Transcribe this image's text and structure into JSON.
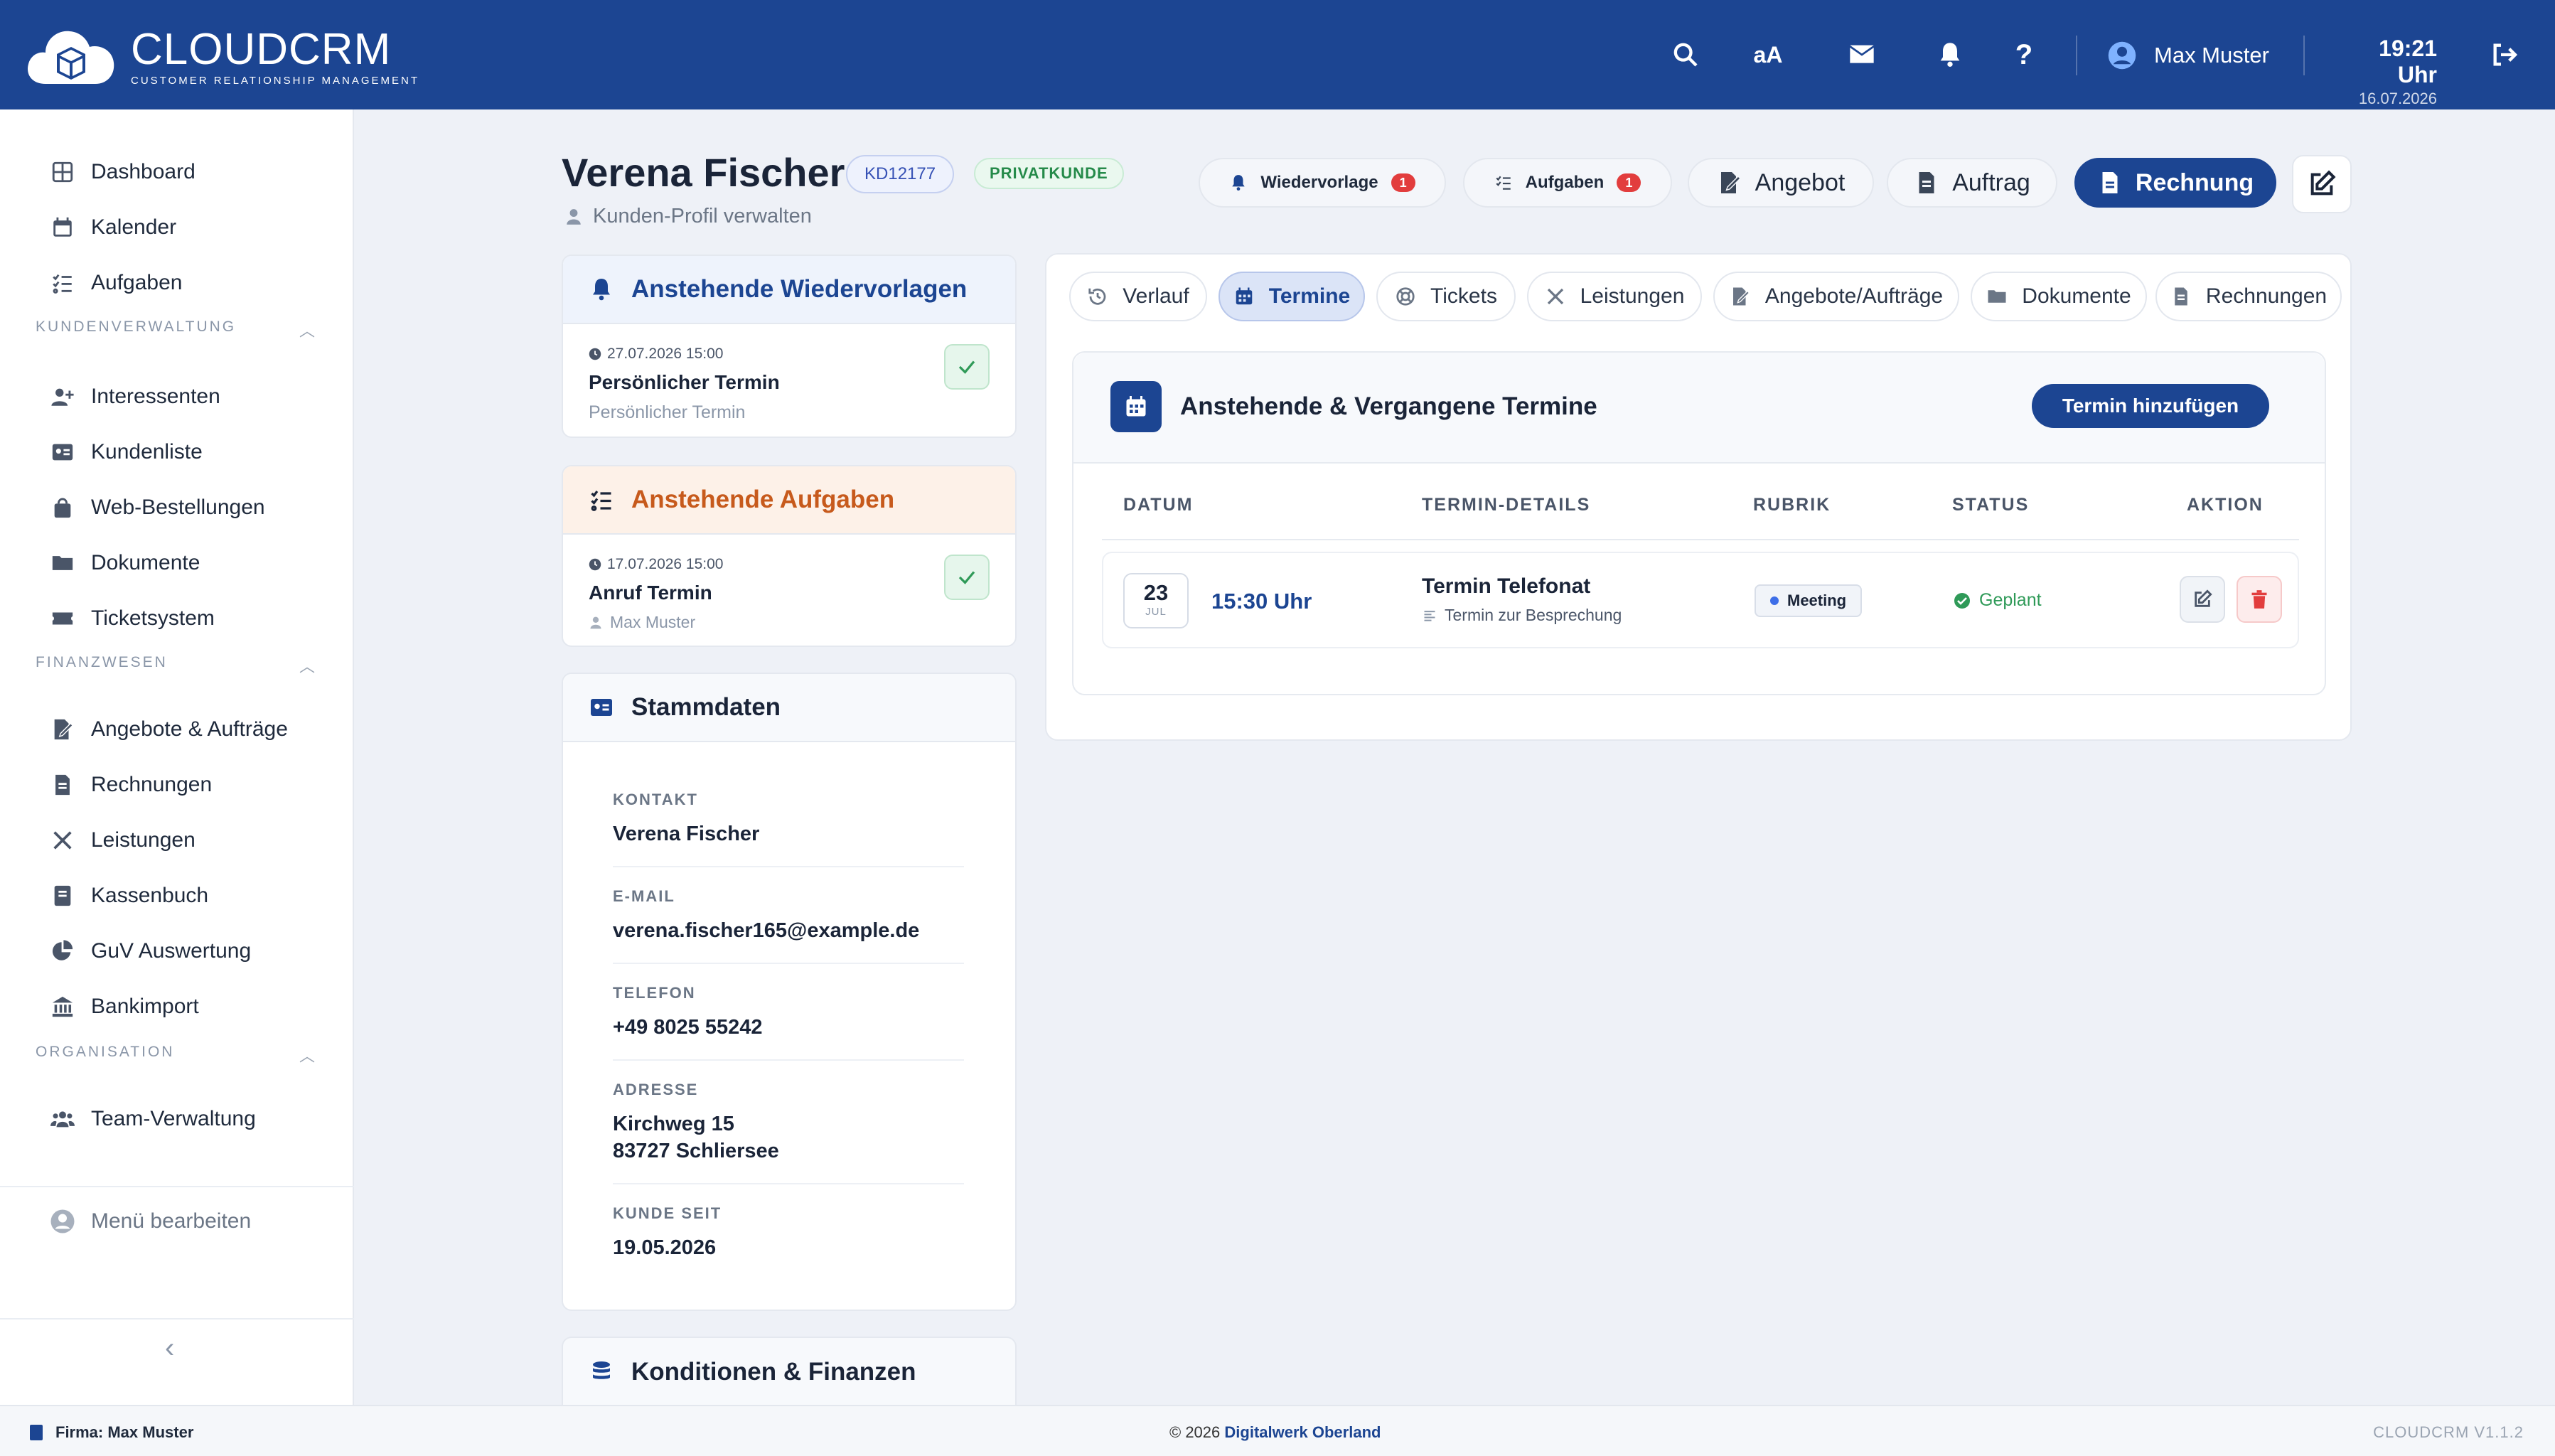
{
  "app": {
    "title": "CLOUDCRM",
    "subtitle": "CUSTOMER RELATIONSHIP MANAGEMENT",
    "font_toggle": "aA",
    "version": "CLOUDCRM V1.1.2"
  },
  "header": {
    "user_name": "Max Muster",
    "time": "19:21 Uhr",
    "date": "16.07.2026"
  },
  "sidebar": {
    "top": [
      {
        "label": "Dashboard",
        "icon": "dashboard-icon"
      },
      {
        "label": "Kalender",
        "icon": "calendar-icon"
      },
      {
        "label": "Aufgaben",
        "icon": "tasks-icon"
      }
    ],
    "sections": [
      {
        "title": "KUNDENVERWALTUNG",
        "items": [
          {
            "label": "Interessenten",
            "icon": "user-plus-icon"
          },
          {
            "label": "Kundenliste",
            "icon": "id-card-icon"
          },
          {
            "label": "Web-Bestellungen",
            "icon": "shopping-bag-icon"
          },
          {
            "label": "Dokumente",
            "icon": "folder-icon"
          },
          {
            "label": "Ticketsystem",
            "icon": "ticket-icon"
          }
        ]
      },
      {
        "title": "FINANZWESEN",
        "items": [
          {
            "label": "Angebote & Aufträge",
            "icon": "file-signature-icon"
          },
          {
            "label": "Rechnungen",
            "icon": "invoice-icon"
          },
          {
            "label": "Leistungen",
            "icon": "tools-icon"
          },
          {
            "label": "Kassenbuch",
            "icon": "book-icon"
          },
          {
            "label": "GuV Auswertung",
            "icon": "pie-chart-icon"
          },
          {
            "label": "Bankimport",
            "icon": "bank-icon"
          }
        ]
      },
      {
        "title": "ORGANISATION",
        "items": [
          {
            "label": "Team-Verwaltung",
            "icon": "team-icon"
          }
        ]
      }
    ],
    "menu_edit": "Menü bearbeiten"
  },
  "profile": {
    "name": "Verena Fischer",
    "customer_id": "KD12177",
    "type": "PRIVATKUNDE",
    "subtitle": "Kunden-Profil verwalten"
  },
  "actions": {
    "wiedervorlage": {
      "label": "Wiedervorlage",
      "count": "1"
    },
    "aufgaben": {
      "label": "Aufgaben",
      "count": "1"
    },
    "angebot": "Angebot",
    "auftrag": "Auftrag",
    "rechnung": "Rechnung"
  },
  "reminders": {
    "title": "Anstehende Wiedervorlagen",
    "item": {
      "datetime": "27.07.2026 15:00",
      "title": "Persönlicher Termin",
      "sub": "Persönlicher Termin"
    }
  },
  "tasks": {
    "title": "Anstehende Aufgaben",
    "item": {
      "datetime": "17.07.2026 15:00",
      "title": "Anruf Termin",
      "sub": "Max Muster"
    }
  },
  "stammdaten": {
    "title": "Stammdaten",
    "fields": [
      {
        "label": "KONTAKT",
        "value": "Verena Fischer"
      },
      {
        "label": "E-MAIL",
        "value": "verena.fischer165@example.de"
      },
      {
        "label": "TELEFON",
        "value": "+49 8025 55242"
      },
      {
        "label": "ADRESSE",
        "value": "Kirchweg 15",
        "value2": "83727 Schliersee"
      },
      {
        "label": "KUNDE SEIT",
        "value": "19.05.2026"
      }
    ]
  },
  "konditionen": {
    "title": "Konditionen & Finanzen"
  },
  "tabs": [
    "Verlauf",
    "Termine",
    "Tickets",
    "Leistungen",
    "Angebote/Aufträge",
    "Dokumente",
    "Rechnungen"
  ],
  "termine": {
    "title": "Anstehende & Vergangene Termine",
    "add_label": "Termin hinzufügen",
    "columns": [
      "DATUM",
      "TERMIN-DETAILS",
      "RUBRIK",
      "STATUS",
      "AKTION"
    ],
    "row": {
      "day": "23",
      "month": "JUL",
      "time": "15:30 Uhr",
      "title": "Termin Telefonat",
      "desc": "Termin zur Besprechung",
      "rubrik": "Meeting",
      "status": "Geplant"
    }
  },
  "footer": {
    "firma": "Firma: Max Muster",
    "copyright": "© 2026 ",
    "company": "Digitalwerk Oberland"
  },
  "colors": {
    "primary": "#1c4592",
    "danger": "#e23d3d",
    "success": "#2f9a58",
    "task_accent": "#c75a1c"
  }
}
